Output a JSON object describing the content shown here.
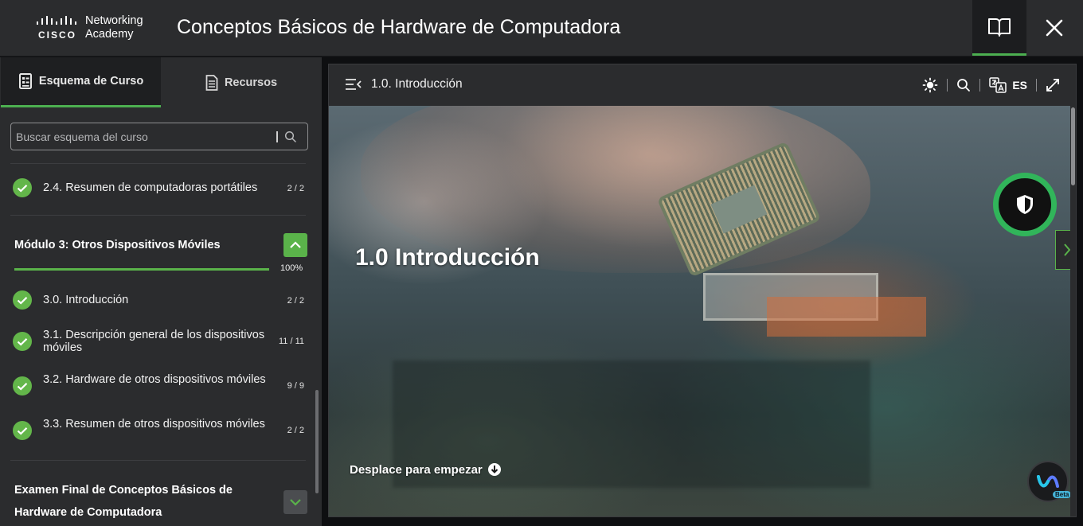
{
  "header": {
    "brand_line1": "Networking",
    "brand_line2": "Academy",
    "brand_cisco": "CISCO",
    "title": "Conceptos Básicos de Hardware de Computadora",
    "book_icon": "book-icon",
    "close_icon": "close-icon"
  },
  "sidebar": {
    "tabs": [
      {
        "label": "Esquema de Curso",
        "icon": "outline-icon",
        "active": true
      },
      {
        "label": "Recursos",
        "icon": "document-icon",
        "active": false
      }
    ],
    "search": {
      "placeholder": "Buscar esquema del curso"
    },
    "items_before": [
      {
        "label": "2.4. Resumen de computadoras portátiles",
        "count": "2 / 2"
      }
    ],
    "module": {
      "title": "Módulo 3: Otros Dispositivos Móviles",
      "progress_percent": 100,
      "progress_label": "100%",
      "expanded": true
    },
    "items": [
      {
        "label": "3.0. Introducción",
        "count": "2 / 2"
      },
      {
        "label": "3.1. Descripción general de los dispositivos móviles",
        "count": "11 / 11"
      },
      {
        "label": "3.2. Hardware de otros dispositivos móviles",
        "count": "9 / 9"
      },
      {
        "label": "3.3. Resumen de otros dispositivos móviles",
        "count": "2 / 2"
      }
    ],
    "exam": {
      "title": "Examen Final de Conceptos Básicos de Hardware de Computadora",
      "expanded": false
    }
  },
  "content": {
    "section_title": "1.0. Introducción",
    "language": "ES",
    "hero_title": "1.0 Introducción",
    "scroll_hint": "Desplace para empezar",
    "webex_badge": "Beta",
    "colors": {
      "accent": "#5ab34a",
      "shield_ring": "#31b55a",
      "background": "#2b2c2e"
    }
  }
}
